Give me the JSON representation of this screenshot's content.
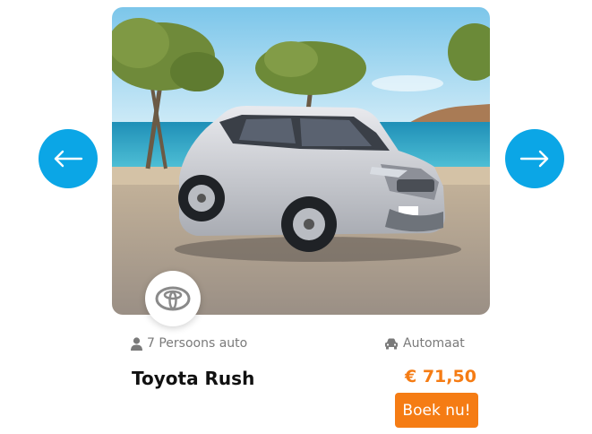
{
  "carousel": {
    "prev_icon": "arrow-left-icon",
    "next_icon": "arrow-right-icon",
    "accent_color": "#0ba6e6"
  },
  "car": {
    "name": "Toyota Rush",
    "brand_logo": "toyota-logo",
    "seats_icon": "person-icon",
    "seats_label": "7 Persoons auto",
    "transmission_icon": "car-icon",
    "transmission_label": "Automaat",
    "price": "€ 71,50",
    "book_label": "Boek nu!",
    "price_color": "#f57c14"
  }
}
